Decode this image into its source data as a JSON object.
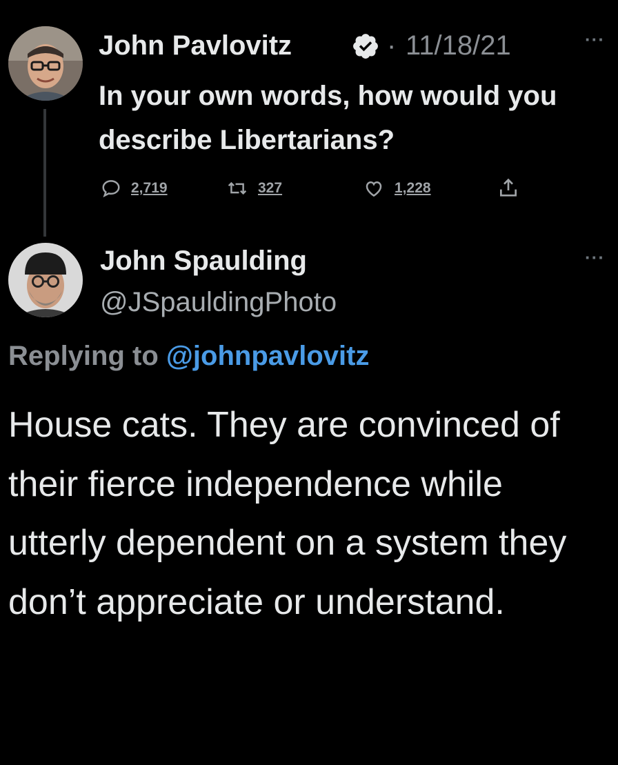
{
  "tweet": {
    "author_name": "John Pavlovitz",
    "separator": "·",
    "date": "11/18/21",
    "text": "In your own words, how would you describe Libertarians?",
    "replies": "2,719",
    "retweets": "327",
    "likes": "1,228",
    "more_icon": "more-icon",
    "verified_color": "#e7e9ea"
  },
  "reply": {
    "author_name": "John Spaulding",
    "handle": "@JSpauldingPhoto",
    "replying_prefix": "Replying to",
    "replying_mention": "@johnpavlovitz",
    "text": "House cats. They are convinced of their fierce independence while utterly dependent on a system they don’t appreciate or understand."
  },
  "colors": {
    "background": "#000000",
    "primary_text": "#e7e9ea",
    "secondary_text": "#8b8f94",
    "link": "#4a9be6"
  },
  "icons": [
    "comment-icon",
    "retweet-icon",
    "like-icon",
    "share-icon",
    "verified-badge-icon"
  ]
}
